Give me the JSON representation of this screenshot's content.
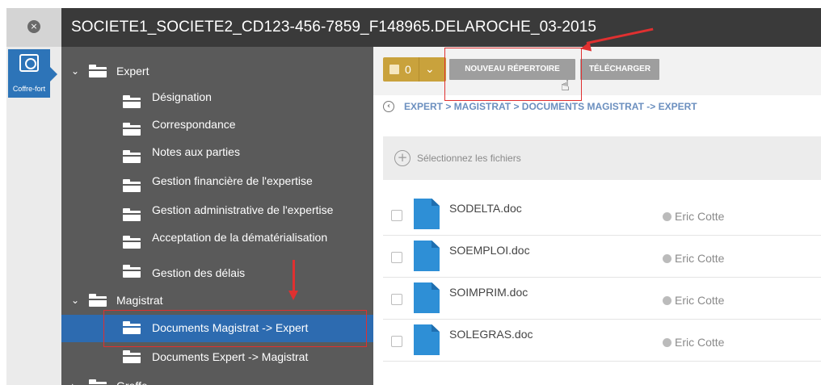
{
  "window": {
    "title": "SOCIETE1_SOCIETE2_CD123-456-7859_F148965.DELAROCHE_03-2015",
    "close_glyph": "×"
  },
  "rail": {
    "items": [
      {
        "label": "Coffre-fort",
        "icon": "safe-icon",
        "active": true
      }
    ]
  },
  "tree": {
    "items": [
      {
        "label": "Expert",
        "level": 0,
        "expanded": true
      },
      {
        "label": "Désignation",
        "level": 1
      },
      {
        "label": "Correspondance",
        "level": 1
      },
      {
        "label": "Notes aux parties",
        "level": 1
      },
      {
        "label": "Gestion financière de l'expertise",
        "level": 1
      },
      {
        "label": "Gestion administrative de l'expertise",
        "level": 1
      },
      {
        "label": "Acceptation de la dématérialisation",
        "level": 1
      },
      {
        "label": "Gestion des délais",
        "level": 1
      },
      {
        "label": "Magistrat",
        "level": 0,
        "expanded": true
      },
      {
        "label": "Documents Magistrat -> Expert",
        "level": 1,
        "selected": true
      },
      {
        "label": "Documents Expert -> Magistrat",
        "level": 1
      },
      {
        "label": "Greffe",
        "level": 0,
        "expanded": true
      }
    ]
  },
  "toolbar": {
    "selected_count": "0",
    "new_folder_label": "NOUVEAU RÉPERTOIRE",
    "download_label": "TÉLÉCHARGER"
  },
  "breadcrumb": {
    "text": "EXPERT > MAGISTRAT > DOCUMENTS MAGISTRAT -> EXPERT"
  },
  "upload": {
    "label": "Sélectionnez les fichiers"
  },
  "files": [
    {
      "name": "SODELTA.doc",
      "owner": "Eric Cotte"
    },
    {
      "name": "SOEMPLOI.doc",
      "owner": "Eric Cotte"
    },
    {
      "name": "SOIMPRIM.doc",
      "owner": "Eric Cotte"
    },
    {
      "name": "SOLEGRAS.doc",
      "owner": "Eric Cotte"
    }
  ],
  "colors": {
    "title_bar": "#3a3a3a",
    "tree_bg": "#5a5a5a",
    "accent_blue": "#2d6bb0",
    "select_button": "#c9a23c",
    "annotation_red": "#e03030"
  }
}
